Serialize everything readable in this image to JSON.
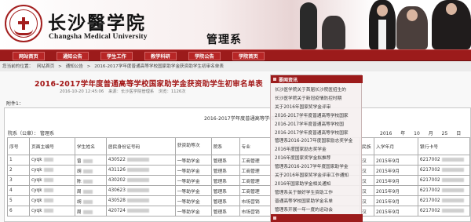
{
  "header": {
    "college_cn": "长沙醫学院",
    "college_en": "Changsha Medical University",
    "section": "管理系"
  },
  "nav": {
    "items": [
      "网站首页",
      "通知公告",
      "学生工作",
      "教学科研",
      "学院公告",
      "学院首页"
    ]
  },
  "breadcrumb": [
    "您当前的位置：",
    "网站首页",
    ">",
    "通知公告",
    ">",
    "2016-2017学年度普通高等学校国家助学金获资助学生初审名单表"
  ],
  "article": {
    "title": "2016-2017学年度普通高等学校国家助学金获资助学生初审名单表",
    "meta_date": "2016-10-20 12:45:06",
    "meta_source": "来源：长沙医学院管理系",
    "meta_views": "浏览：1126次",
    "attachment_label": "附件1："
  },
  "document": {
    "title": "2016-2017学年度普通高等学校国家助学金获资助学生初审名单表",
    "dept_prefix": "院系（公章）：",
    "dept_value": "管理系",
    "year": "2016",
    "year_unit": "年",
    "month": "10",
    "month_unit": "月",
    "day": "25",
    "day_unit": "日"
  },
  "table": {
    "headers": [
      "序号",
      "页面主编号",
      "学生姓名",
      "居民身份证号码",
      "获资助等次",
      "院系",
      "专业",
      "班级",
      "民族",
      "入学年月",
      "银行卡号"
    ],
    "rows": [
      [
        "1",
        "cyqk",
        "曾",
        "430522",
        "一等助学金",
        "管理系",
        "工商管理",
        "",
        "汉",
        "2015年9月",
        "6217002"
      ],
      [
        "2",
        "cyqk",
        "胡",
        "431126",
        "一等助学金",
        "管理系",
        "工商管理",
        "",
        "汉",
        "2015年9月",
        "6217002"
      ],
      [
        "3",
        "cyqk",
        "陈",
        "430202",
        "一等助学金",
        "管理系",
        "工商管理",
        "",
        "汉",
        "2015年9月",
        "6217002"
      ],
      [
        "4",
        "cyqk",
        "周",
        "430623",
        "一等助学金",
        "管理系",
        "工商管理",
        "",
        "汉",
        "2015年9月",
        "6217002"
      ],
      [
        "5",
        "cyqk",
        "胡",
        "430528",
        "一等助学金",
        "管理系",
        "市场营销",
        "",
        "汉",
        "2015年9月",
        "6217002"
      ],
      [
        "6",
        "cyqk",
        "周",
        "420724",
        "一等助学金",
        "管理系",
        "市场营销",
        "",
        "汉",
        "2015年9月",
        "6217002"
      ]
    ]
  },
  "news": {
    "header": "要闻资讯",
    "items": [
      "长沙医学院关于首届长沙院医招生的",
      "长沙医学院关于新冠疫情防控时期",
      "关于2016年国家奖学金评审",
      "2016-2017学年度普通高等学校国家",
      "2016-2017学年度普通高等学校国",
      "2016-2017学年度普通高等学校国家",
      "管理系2016-2017年度国家励志奖学金",
      "2016年度国家励志奖学金",
      "2016年度国家奖学金拟推荐",
      "管理系2016-2017学年度国家助学金",
      "关于2016年国家奖学金评审工作通知",
      "2016年国家助学金相关通知",
      "管理系关于做好学生资助工作",
      "普通高等学校国家助学金名单",
      "管理系开展一年一度的运动会"
    ]
  },
  "colors": {
    "brand_red": "#9c1b1b",
    "title_red": "#a31616"
  }
}
